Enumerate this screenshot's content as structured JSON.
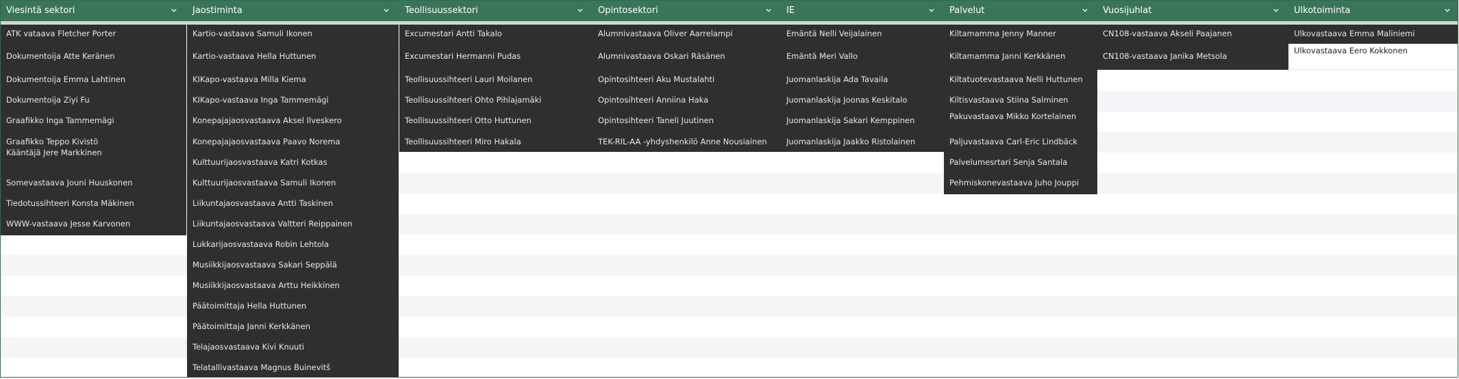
{
  "columns": [
    {
      "header": "Viesintä sektori",
      "items": [
        "ATK vataava Fletcher Porter",
        "Dokumentoija Atte Keränen",
        "Dokumentoija Emma Lahtinen",
        "Dokumentoija Ziyi Fu",
        "Graafikko Inga Tammemägi",
        "Graafikko Teppo Kivistö",
        "Kääntäjä Jere Markkinen",
        "Somevastaava Jouni Huuskonen",
        "Tiedotussihteeri Konsta Mäkinen",
        "WWW-vastaava Jesse Karvonen"
      ]
    },
    {
      "header": "Jaostiminta",
      "items": [
        "Kartio-vastaava Samuli Ikonen",
        "Kartio-vastaava Hella Huttunen",
        "KIKapo-vastaava Milla Kiema",
        "KIKapo-vastaava Inga Tammemägi",
        "Konepajajaosvastaava Aksel Ilveskero",
        "Konepajajaosvastaava Paavo Norema",
        "Kulttuurijaosvastaava Katri Kotkas",
        "Kulttuurijaosvastaava Samuli Ikonen",
        "Liikuntajaosvastaava Antti Taskinen",
        "Liikuntajaosvastaava Valtteri Reippainen",
        "Lukkarijaosvastaava Robin Lehtola",
        "Musiikkijaosvastaava Sakari Seppälä",
        "Musiikkijaosvastaava Arttu Heikkinen",
        "Päätoimittaja Hella Huttunen",
        "Päätoimittaja Janni Kerkkänen",
        "Telajaosvastaava Kivi Knuuti",
        "Telatallivastaava Magnus Buinevitš"
      ]
    },
    {
      "header": "Teollisuussektori",
      "items": [
        "Excumestari Antti Takalo",
        "Excumestari Hermanni Pudas",
        "Teollisuussihteeri Lauri Moilanen",
        "Teollisuussihteeri Ohto Pihlajamäki",
        "Teollisuussihteeri Otto Huttunen",
        "Teollisuussihteeri Miro Hakala"
      ]
    },
    {
      "header": "Opintosektori",
      "items": [
        "Alumnivastaava Oliver Aarrelampi",
        "Alumnivastaava Oskari Räsänen",
        "Opintosihteeri Aku Mustalahti",
        "Opintosihteeri Anniina Haka",
        "Opintosihteeri Taneli Juutinen",
        "TEK-RIL-AA -yhdyshenkilö Anne Nousiainen"
      ]
    },
    {
      "header": "IE",
      "items": [
        "Emäntä Nelli Veijalainen",
        "Emäntä Meri Vallo",
        "Juomanlaskija Ada Tavaila",
        "Juomanlaskija Joonas Keskitalo",
        "Juomanlaskija Sakari Kemppinen",
        "Juomanlaskija Jaakko Ristolainen"
      ]
    },
    {
      "header": "Palvelut",
      "items": [
        "Kiltamamma Jenny Manner",
        "Kiltamamma Janni Kerkkänen",
        "Kiltatuotevastaava Nelli Huttunen",
        "Kiltisvastaava Stiina Salminen",
        "Pakuvastaava Mikko Kortelainen",
        "Paljuvastaava Carl-Eric Lindbäck",
        "Palvelumesrtari Senja Santala",
        "Pehmiskonevastaava Juho Jouppi"
      ]
    },
    {
      "header": "Vuosijuhlat",
      "items": [
        "CN108-vastaava Akseli Paajanen",
        "CN108-vastaava Janika Metsola"
      ]
    },
    {
      "header": "Ulkotoiminta",
      "items": [
        "Ulkovastaava Emma Maliniemi",
        "Ulkovastaava Eero Kokkonen"
      ]
    }
  ]
}
